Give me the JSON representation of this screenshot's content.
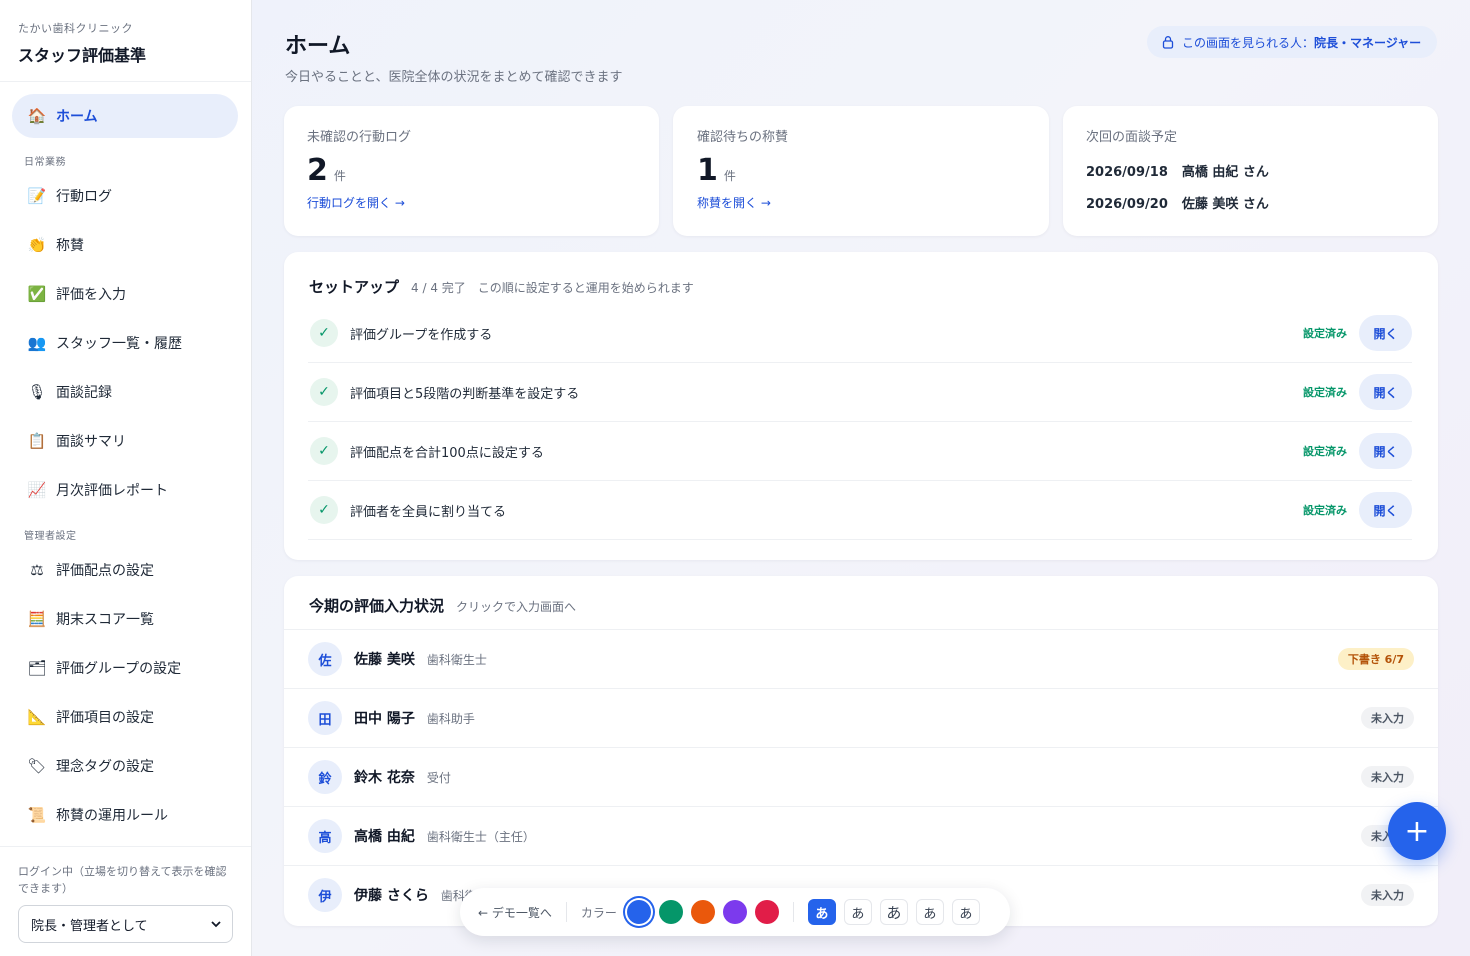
{
  "sidebar": {
    "clinic_name": "たかい歯科クリニック",
    "app_title": "スタッフ評価基準",
    "home": {
      "label": "ホーム",
      "icon": "🏠"
    },
    "section_daily": "日常業務",
    "daily_items": [
      {
        "label": "行動ログ",
        "icon": "📝"
      },
      {
        "label": "称賛",
        "icon": "👏"
      },
      {
        "label": "評価を入力",
        "icon": "✅"
      },
      {
        "label": "スタッフ一覧・履歴",
        "icon": "👥"
      },
      {
        "label": "面談記録",
        "icon": "🎙"
      },
      {
        "label": "面談サマリ",
        "icon": "📋"
      },
      {
        "label": "月次評価レポート",
        "icon": "📈"
      }
    ],
    "section_admin": "管理者設定",
    "admin_items": [
      {
        "label": "評価配点の設定",
        "icon": "⚖"
      },
      {
        "label": "期末スコア一覧",
        "icon": "🧮"
      },
      {
        "label": "評価グループの設定",
        "icon": "🗂"
      },
      {
        "label": "評価項目の設定",
        "icon": "📐"
      },
      {
        "label": "理念タグの設定",
        "icon": "🏷"
      },
      {
        "label": "称賛の運用ルール",
        "icon": "📜"
      }
    ],
    "login_note": "ログイン中（立場を切り替えて表示を確認できます）",
    "role_value": "院長・管理者として"
  },
  "header": {
    "title": "ホーム",
    "subtitle": "今日やることと、医院全体の状況をまとめて確認できます",
    "access_prefix": "この画面を見られる人：",
    "access_roles": "院長・マネージャー"
  },
  "stats": {
    "unconfirmed_logs": {
      "label": "未確認の行動ログ",
      "count": "2",
      "unit": "件",
      "link": "行動ログを開く →"
    },
    "pending_praise": {
      "label": "確認待ちの称賛",
      "count": "1",
      "unit": "件",
      "link": "称賛を開く →"
    },
    "next_interview": {
      "label": "次回の面談予定",
      "entries": [
        {
          "date": "2026/09/18",
          "name": "高橋 由紀 さん"
        },
        {
          "date": "2026/09/20",
          "name": "佐藤 美咲 さん"
        }
      ]
    }
  },
  "setup": {
    "title": "セットアップ",
    "progress": "4 / 4 完了",
    "note": "この順に設定すると運用を始められます",
    "status_label": "設定済み",
    "open_label": "開く",
    "check_mark": "✓",
    "steps": [
      "評価グループを作成する",
      "評価項目と5段階の判断基準を設定する",
      "評価配点を合計100点に設定する",
      "評価者を全員に割り当てる"
    ]
  },
  "evaluation": {
    "title": "今期の評価入力状況",
    "note": "クリックで入力画面へ",
    "staff": [
      {
        "initial": "佐",
        "name": "佐藤 美咲",
        "role": "歯科衛生士",
        "status": "下書き 6/7",
        "type": "draft"
      },
      {
        "initial": "田",
        "name": "田中 陽子",
        "role": "歯科助手",
        "status": "未入力",
        "type": "empty"
      },
      {
        "initial": "鈴",
        "name": "鈴木 花奈",
        "role": "受付",
        "status": "未入力",
        "type": "empty"
      },
      {
        "initial": "高",
        "name": "高橋 由紀",
        "role": "歯科衛生士（主任）",
        "status": "未入力",
        "type": "empty"
      },
      {
        "initial": "伊",
        "name": "伊藤 さくら",
        "role": "歯科衛生士",
        "status": "未入力",
        "type": "empty"
      }
    ]
  },
  "fab": {
    "icon": "plus-icon",
    "glyph": "+"
  },
  "demo_bar": {
    "back": "← デモ一覧へ",
    "color_label": "カラー",
    "colors": [
      "#2563eb",
      "#059669",
      "#ea580c",
      "#7c3aed",
      "#e11d48"
    ],
    "font_glyphs": [
      "あ",
      "あ",
      "あ",
      "あ",
      "あ"
    ]
  },
  "colors": {
    "accent": "#2563eb",
    "success": "#059669",
    "draft": "#b45309"
  }
}
